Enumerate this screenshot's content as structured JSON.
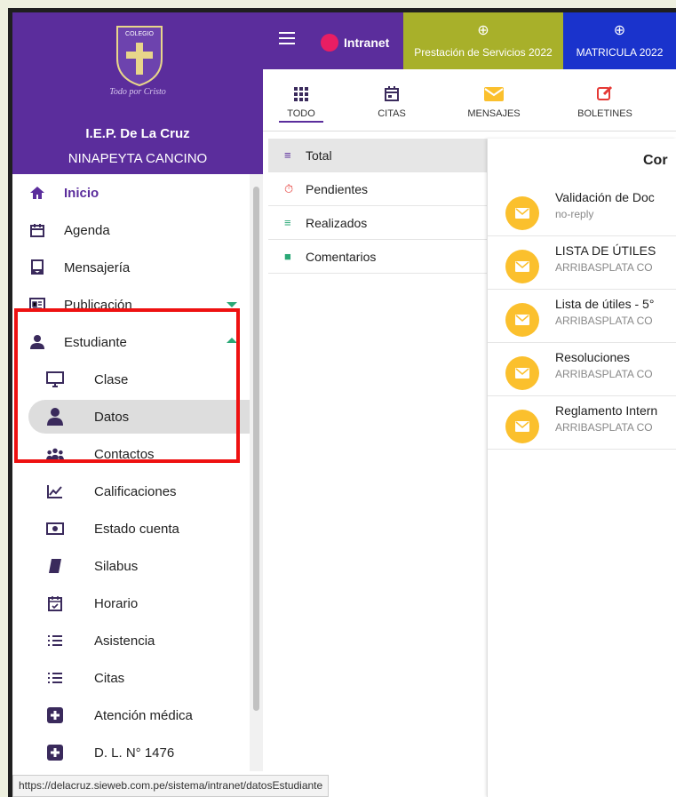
{
  "sidebar": {
    "motto": "Todo por Cristo",
    "school": "I.E.P. De La Cruz",
    "student": "NINAPEYTA CANCINO",
    "items": [
      {
        "label": "Inicio",
        "icon": "home-icon"
      },
      {
        "label": "Agenda",
        "icon": "calendar-icon"
      },
      {
        "label": "Mensajería",
        "icon": "message-icon"
      },
      {
        "label": "Publicación",
        "icon": "newspaper-icon"
      },
      {
        "label": "Estudiante",
        "icon": "student-icon"
      },
      {
        "label": "Clase",
        "icon": "monitor-icon"
      },
      {
        "label": "Datos",
        "icon": "person-icon"
      },
      {
        "label": "Contactos",
        "icon": "group-icon"
      },
      {
        "label": "Calificaciones",
        "icon": "chart-icon"
      },
      {
        "label": "Estado cuenta",
        "icon": "money-icon"
      },
      {
        "label": "Silabus",
        "icon": "book-icon"
      },
      {
        "label": "Horario",
        "icon": "calendar-check-icon"
      },
      {
        "label": "Asistencia",
        "icon": "list-icon"
      },
      {
        "label": "Citas",
        "icon": "list-icon"
      },
      {
        "label": "Atención médica",
        "icon": "plus-box-icon"
      },
      {
        "label": "D. L. N° 1476",
        "icon": "plus-box-icon"
      }
    ]
  },
  "status_url": "https://delacruz.sieweb.com.pe/sistema/intranet/datosEstudiante",
  "topbar": {
    "intranet": "Intranet",
    "tab_prestacion": "Prestación de Servicios 2022",
    "tab_matricula": "MATRICULA 2022"
  },
  "toolbar": {
    "todo": "TODO",
    "citas": "CITAS",
    "mensajes": "MENSAJES",
    "boletines": "BOLETINES"
  },
  "filters": {
    "total": "Total",
    "pendientes": "Pendientes",
    "realizados": "Realizados",
    "comentarios": "Comentarios"
  },
  "panel": {
    "title": "Cor",
    "messages": [
      {
        "subject": "Validación de Doc",
        "from": "no-reply"
      },
      {
        "subject": "LISTA DE ÚTILES",
        "from": "ARRIBASPLATA CO"
      },
      {
        "subject": "Lista de útiles - 5°",
        "from": "ARRIBASPLATA CO"
      },
      {
        "subject": "Resoluciones",
        "from": "ARRIBASPLATA CO"
      },
      {
        "subject": "Reglamento Intern",
        "from": "ARRIBASPLATA CO"
      }
    ]
  },
  "colors": {
    "brand": "#5b2d9c",
    "prestacion": "#a8b02a",
    "matricula": "#1a33cc",
    "envelope": "#fbc02d",
    "highlight": "#ee1111"
  }
}
